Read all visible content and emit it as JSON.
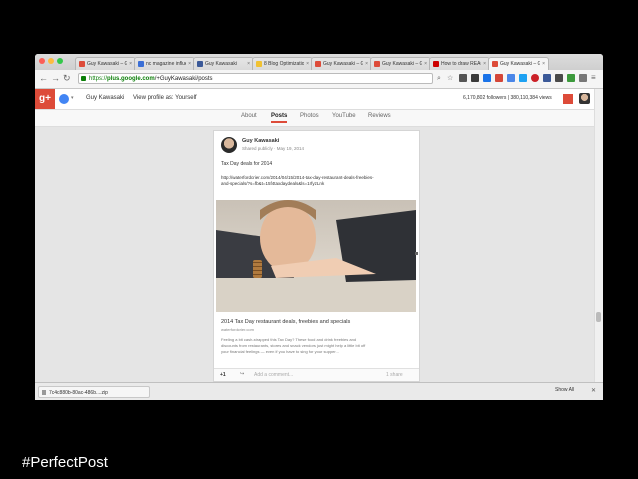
{
  "browser": {
    "tabs": [
      {
        "label": "Guy Kawasaki – Goo",
        "fav": "#dd4b39"
      },
      {
        "label": "nc magazine influe",
        "fav": "#3b6fd6"
      },
      {
        "label": "Guy Kawasaki",
        "fav": "#3b5998"
      },
      {
        "label": "8 Blog Optimizatio",
        "fav": "#f1c232"
      },
      {
        "label": "Guy Kawasaki – Goo",
        "fav": "#dd4b39"
      },
      {
        "label": "Guy Kawasaki – Goo",
        "fav": "#dd4b39"
      },
      {
        "label": "How to draw REACT",
        "fav": "#cc0000"
      },
      {
        "label": "Guy Kawasaki – Goo",
        "fav": "#dd4b39",
        "active": true
      }
    ],
    "url_scheme": "https://",
    "url_host": "plus.google.com",
    "url_path": "/+GuyKawasaki/posts"
  },
  "gplus": {
    "logo": "g+",
    "user_name": "Guy Kawasaki",
    "view_as": "View profile as: Yourself",
    "stats": "6,170,802 followers | 380,110,384 views",
    "tabs": [
      "About",
      "Posts",
      "Photos",
      "YouTube",
      "Reviews"
    ]
  },
  "post": {
    "author": "Guy Kawasaki",
    "meta": "Shared publicly  ·  May 19, 2014",
    "body": "Tax Day deals for 2014",
    "link1": "http://waterfordcrier.com/2014/04/15/2014-tax-day-restaurant-deals-freebies-",
    "link2": "and-specials/?s=fb&t=15f4taxdaydeals&ls=1rfyzLnk",
    "card_title": "2014 Tax Day restaurant deals, freebies and specials",
    "card_source": "waterfordcrier.com",
    "card_desc1": "Feeling a bit cash-strapped this Tax Day? These food and drink freebies and",
    "card_desc2": "discounts from restaurants, stores and snack vendors just might help a little bit off",
    "card_desc3": "your financial feelings — even if you have to sing for your supper...",
    "plus_one": "+1",
    "comment_placeholder": "Add a comment...",
    "share_label": "1 share"
  },
  "download": {
    "filename": "7c4c880b-80ac-486b....zip",
    "show_all": "Show All"
  },
  "caption": "#PerfectPost"
}
